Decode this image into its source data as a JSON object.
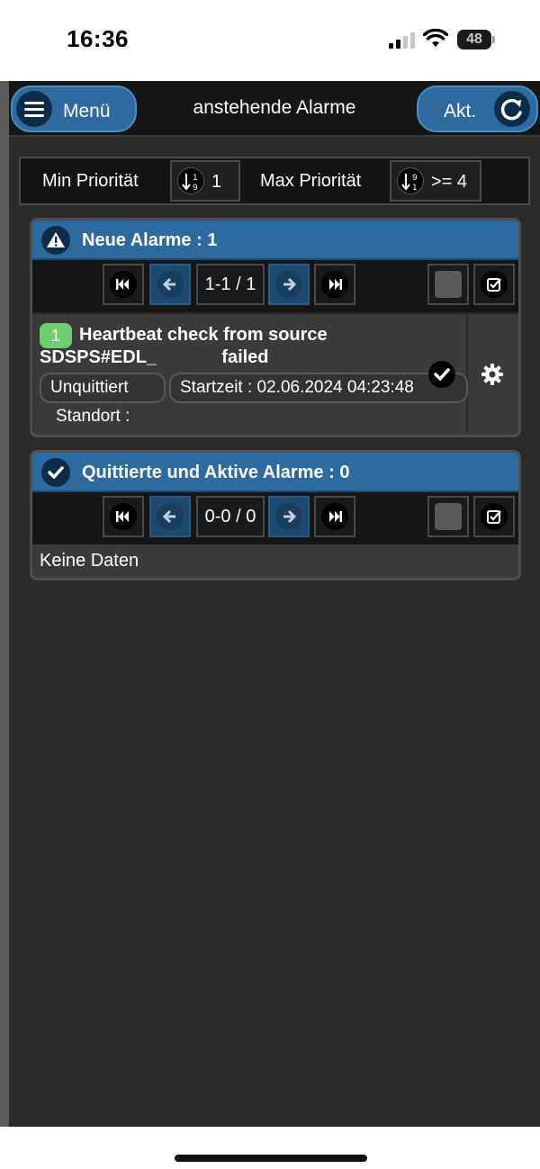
{
  "status_bar": {
    "time": "16:36",
    "battery": "48"
  },
  "topbar": {
    "menu_label": "Menü",
    "title": "anstehende Alarme",
    "refresh_label": "Akt."
  },
  "priority_filter": {
    "min_label": "Min Priorität",
    "min_value": "1",
    "max_label": "Max Priorität",
    "max_value": ">= 4"
  },
  "new_alarms": {
    "title": "Neue Alarme : 1",
    "pager": "1-1 / 1",
    "items": [
      {
        "priority": "1",
        "title_line1": "Heartbeat check from source",
        "title_line2": "SDSPS#EDL_             failed",
        "state": "Unquittiert",
        "start_time": "Startzeit : 02.06.2024 04:23:48",
        "location": "Standort :"
      }
    ]
  },
  "acked_alarms": {
    "title": "Quittierte und Aktive Alarme : 0",
    "pager": "0-0 / 0",
    "empty_text": "Keine Daten"
  },
  "colors": {
    "accent_blue": "#2d6aa0",
    "priority_green": "#6fcf6f",
    "background": "#2a2a2a"
  }
}
